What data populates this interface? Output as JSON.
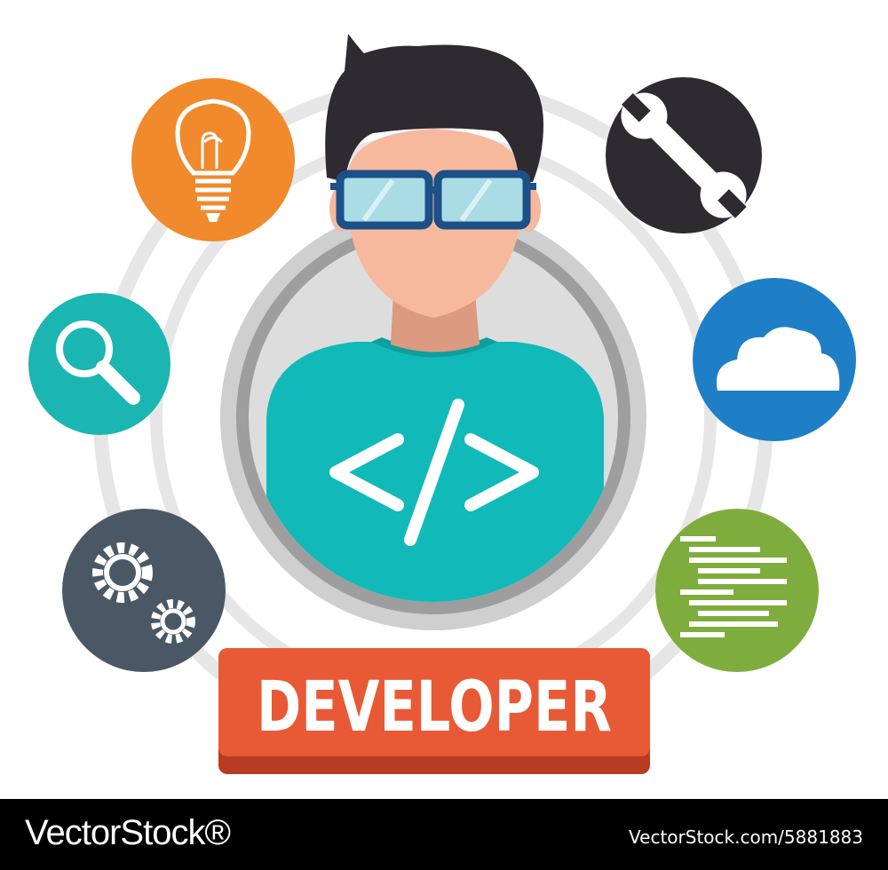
{
  "illustration": {
    "badge": {
      "label": "DEVELOPER"
    },
    "figure": {
      "shirt_symbol": "</>"
    },
    "icons": [
      {
        "icon": "lightbulb-icon",
        "color": "#f08a2c"
      },
      {
        "icon": "wrench-icon",
        "color": "#2d2a30"
      },
      {
        "icon": "magnifier-icon",
        "color": "#1bb5b2"
      },
      {
        "icon": "cloud-icon",
        "color": "#1e7fc6"
      },
      {
        "icon": "gears-icon",
        "color": "#4a5866"
      },
      {
        "icon": "code-lines-icon",
        "color": "#7fad3d"
      }
    ],
    "colors": {
      "badge": "#e85a35",
      "shirt": "#12b9b9",
      "skin": "#f6b99e",
      "hair": "#2d2a30",
      "glasses": "#1d4f88",
      "rings": "#e6e6e6"
    }
  },
  "footer": {
    "brand": "VectorStock®",
    "image_id": "VectorStock.com/5881883"
  }
}
